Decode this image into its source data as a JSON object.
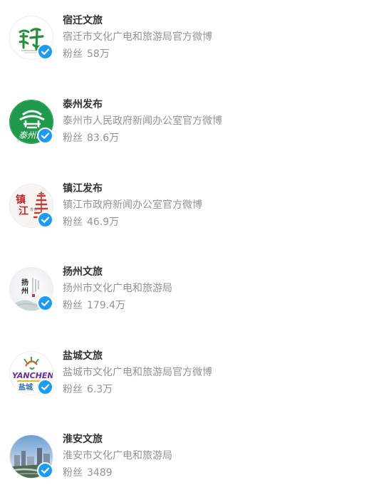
{
  "fans_label": "粉丝",
  "accounts": [
    {
      "name": "宿迁文旅",
      "description": "宿迁市文化广电和旅游局官方微博",
      "followers": "58万",
      "avatar_icon": "suqian-culture-tourism-logo"
    },
    {
      "name": "泰州发布",
      "description": "泰州市人民政府新闻办公室官方微博",
      "followers": "83.6万",
      "avatar_icon": "taizhou-release-logo"
    },
    {
      "name": "镇江发布",
      "description": "镇江市政府新闻办公室官方微博",
      "followers": "46.9万",
      "avatar_icon": "zhenjiang-release-logo"
    },
    {
      "name": "扬州文旅",
      "description": "扬州市文化广电和旅游局",
      "followers": "179.4万",
      "avatar_icon": "yangzhou-culture-tourism-logo"
    },
    {
      "name": "盐城文旅",
      "description": "盐城市文化广电和旅游局官方微博",
      "followers": "6.3万",
      "avatar_icon": "yancheng-culture-tourism-logo"
    },
    {
      "name": "淮安文旅",
      "description": "淮安市文化广电和旅游局",
      "followers": "3489",
      "avatar_icon": "huaian-city-photo"
    }
  ],
  "colors": {
    "name": "#333333",
    "secondary": "#939393",
    "verified_badge": "#1d9bf0",
    "taizhou_green": "#1f9a4c"
  }
}
